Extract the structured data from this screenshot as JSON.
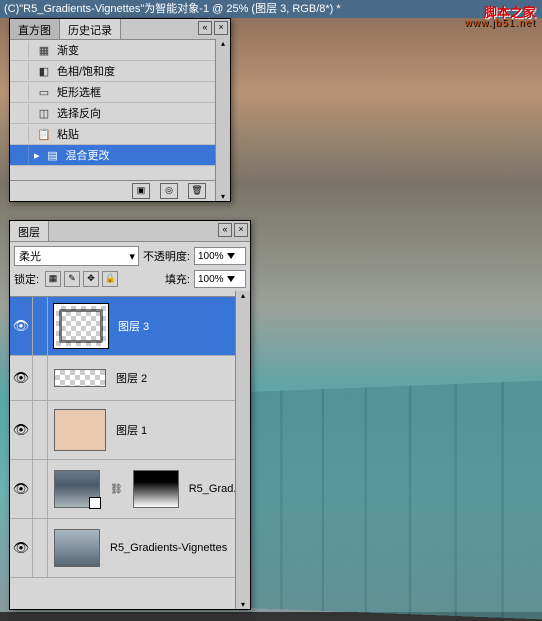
{
  "titlebar": "(C)\"R5_Gradients-Vignettes\"为智能对象-1 @ 25% (图层 3, RGB/8*) *",
  "watermark": {
    "main": "脚本之家",
    "sub": "www.jb51.net"
  },
  "history_panel": {
    "tabs": {
      "tab1": "直方图",
      "tab2": "历史记录"
    },
    "items": [
      {
        "icon": "gradient",
        "label": "渐变"
      },
      {
        "icon": "adjust",
        "label": "色相/饱和度"
      },
      {
        "icon": "marquee",
        "label": "矩形选框"
      },
      {
        "icon": "select",
        "label": "选择反向"
      },
      {
        "icon": "paste",
        "label": "粘贴"
      },
      {
        "icon": "blend",
        "label": "混合更改",
        "selected": true
      }
    ]
  },
  "layers_panel": {
    "title": "图层",
    "blend_mode": "柔光",
    "opacity_label": "不透明度:",
    "opacity_value": "100%",
    "lock_label": "锁定:",
    "fill_label": "填充:",
    "fill_value": "100%",
    "layers": [
      {
        "name": "图层 3",
        "selected": true
      },
      {
        "name": "图层 2"
      },
      {
        "name": "图层 1"
      },
      {
        "name": "R5_Grad..."
      },
      {
        "name": "R5_Gradients-Vignettes"
      }
    ]
  }
}
